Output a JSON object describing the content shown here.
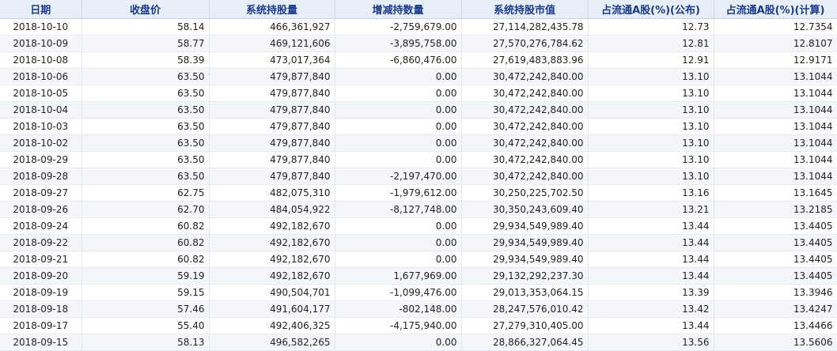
{
  "table": {
    "headers": [
      "日期",
      "收盘价",
      "系统持股量",
      "增减持数量",
      "系统持股市值",
      "占流通A股(%)(公布)",
      "占流通A股(%)(计算)"
    ],
    "rows": [
      [
        "2018-10-10",
        "58.14",
        "466,361,927",
        "-2,759,679.00",
        "27,114,282,435.78",
        "12.73",
        "12.7354"
      ],
      [
        "2018-10-09",
        "58.77",
        "469,121,606",
        "-3,895,758.00",
        "27,570,276,784.62",
        "12.81",
        "12.8107"
      ],
      [
        "2018-10-08",
        "58.39",
        "473,017,364",
        "-6,860,476.00",
        "27,619,483,883.96",
        "12.91",
        "12.9171"
      ],
      [
        "2018-10-06",
        "63.50",
        "479,877,840",
        "0.00",
        "30,472,242,840.00",
        "13.10",
        "13.1044"
      ],
      [
        "2018-10-05",
        "63.50",
        "479,877,840",
        "0.00",
        "30,472,242,840.00",
        "13.10",
        "13.1044"
      ],
      [
        "2018-10-04",
        "63.50",
        "479,877,840",
        "0.00",
        "30,472,242,840.00",
        "13.10",
        "13.1044"
      ],
      [
        "2018-10-03",
        "63.50",
        "479,877,840",
        "0.00",
        "30,472,242,840.00",
        "13.10",
        "13.1044"
      ],
      [
        "2018-10-02",
        "63.50",
        "479,877,840",
        "0.00",
        "30,472,242,840.00",
        "13.10",
        "13.1044"
      ],
      [
        "2018-09-29",
        "63.50",
        "479,877,840",
        "0.00",
        "30,472,242,840.00",
        "13.10",
        "13.1044"
      ],
      [
        "2018-09-28",
        "63.50",
        "479,877,840",
        "-2,197,470.00",
        "30,472,242,840.00",
        "13.10",
        "13.1044"
      ],
      [
        "2018-09-27",
        "62.75",
        "482,075,310",
        "-1,979,612.00",
        "30,250,225,702.50",
        "13.16",
        "13.1645"
      ],
      [
        "2018-09-26",
        "62.70",
        "484,054,922",
        "-8,127,748.00",
        "30,350,243,609.40",
        "13.21",
        "13.2185"
      ],
      [
        "2018-09-24",
        "60.82",
        "492,182,670",
        "0.00",
        "29,934,549,989.40",
        "13.44",
        "13.4405"
      ],
      [
        "2018-09-22",
        "60.82",
        "492,182,670",
        "0.00",
        "29,934,549,989.40",
        "13.44",
        "13.4405"
      ],
      [
        "2018-09-21",
        "60.82",
        "492,182,670",
        "0.00",
        "29,934,549,989.40",
        "13.44",
        "13.4405"
      ],
      [
        "2018-09-20",
        "59.19",
        "492,182,670",
        "1,677,969.00",
        "29,132,292,237.30",
        "13.44",
        "13.4405"
      ],
      [
        "2018-09-19",
        "59.15",
        "490,504,701",
        "-1,099,476.00",
        "29,013,353,064.15",
        "13.39",
        "13.3946"
      ],
      [
        "2018-09-18",
        "57.46",
        "491,604,177",
        "-802,148.00",
        "28,247,576,010.42",
        "13.42",
        "13.4247"
      ],
      [
        "2018-09-17",
        "55.40",
        "492,406,325",
        "-4,175,940.00",
        "27,279,310,405.00",
        "13.44",
        "13.4466"
      ],
      [
        "2018-09-15",
        "58.13",
        "496,582,265",
        "0.00",
        "28,866,327,064.45",
        "13.56",
        "13.5606"
      ]
    ]
  }
}
